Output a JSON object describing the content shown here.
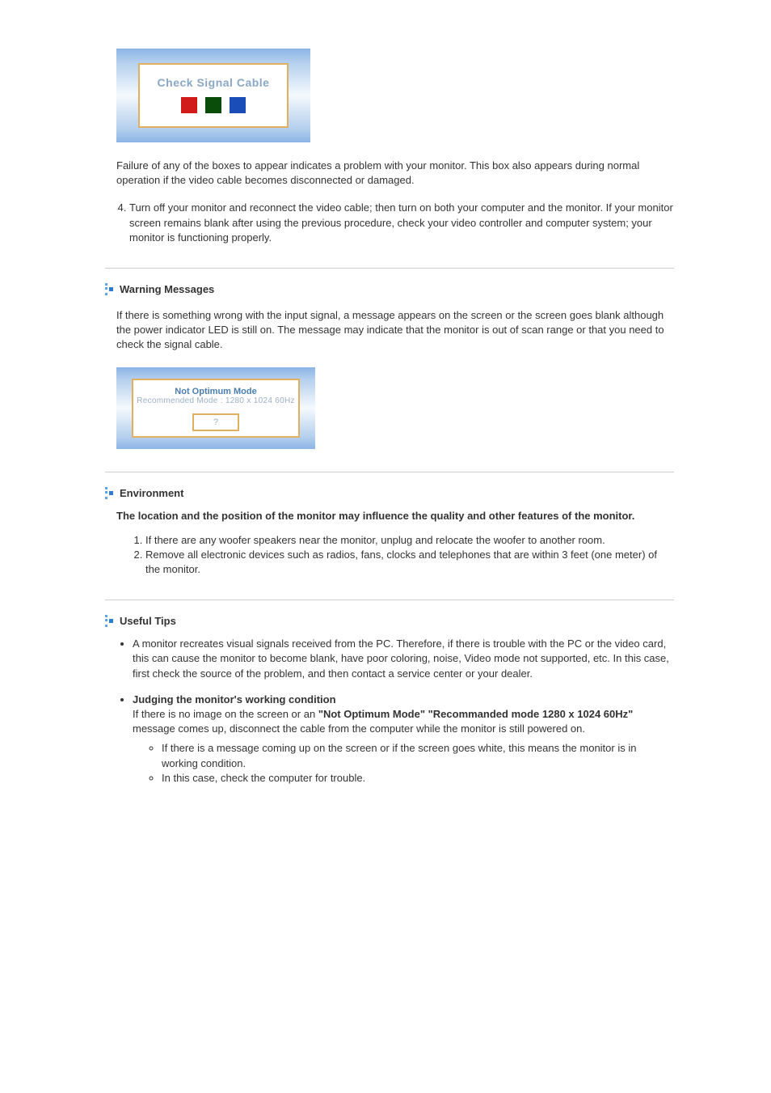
{
  "sig_box": {
    "text": "Check Signal Cable"
  },
  "para_failure": "Failure of any of the boxes to appear indicates a problem with your monitor. This box also appears during normal operation if the video cable becomes disconnected or damaged.",
  "step4": "Turn off your monitor and reconnect the video cable; then turn on both your computer and the monitor. If your monitor screen remains blank after using the previous procedure, check your video controller and computer system; your monitor is functioning properly.",
  "warning": {
    "heading": "Warning Messages",
    "body": "If there is something wrong with the input signal, a message appears on the screen or the screen goes blank although the power indicator LED is still on. The message may indicate that the monitor is out of scan range or that you need to check the signal cable.",
    "box_line1": "Not Optimum Mode",
    "box_line2": "Recommended Mode : 1280 x 1024  60Hz",
    "box_btn": "?"
  },
  "env": {
    "heading": "Environment",
    "intro": "The location and the position of the monitor may influence the quality and other features of the monitor.",
    "item1": "If there are any woofer speakers near the monitor, unplug and relocate the woofer to another room.",
    "item2": "Remove all electronic devices such as radios, fans, clocks and telephones that are within 3 feet (one meter) of the monitor."
  },
  "tips": {
    "heading": "Useful Tips",
    "item1": "A monitor recreates visual signals received from the PC. Therefore, if there is trouble with the PC or the video card, this can cause the monitor to become blank, have poor coloring, noise, Video mode not supported, etc. In this case, first check the source of the problem, and then contact a service center or your dealer.",
    "item2_title": "Judging the monitor's working condition",
    "item2_pre": "If there is no image on the screen or an ",
    "item2_quote": "\"Not Optimum Mode\" \"Recommanded mode 1280 x 1024 60Hz\"",
    "item2_post": " message comes up, disconnect the cable from the computer while the monitor is still powered on.",
    "sub1": "If there is a message coming up on the screen or if the screen goes white, this means the monitor is in working condition.",
    "sub2": "In this case, check the computer for trouble."
  }
}
